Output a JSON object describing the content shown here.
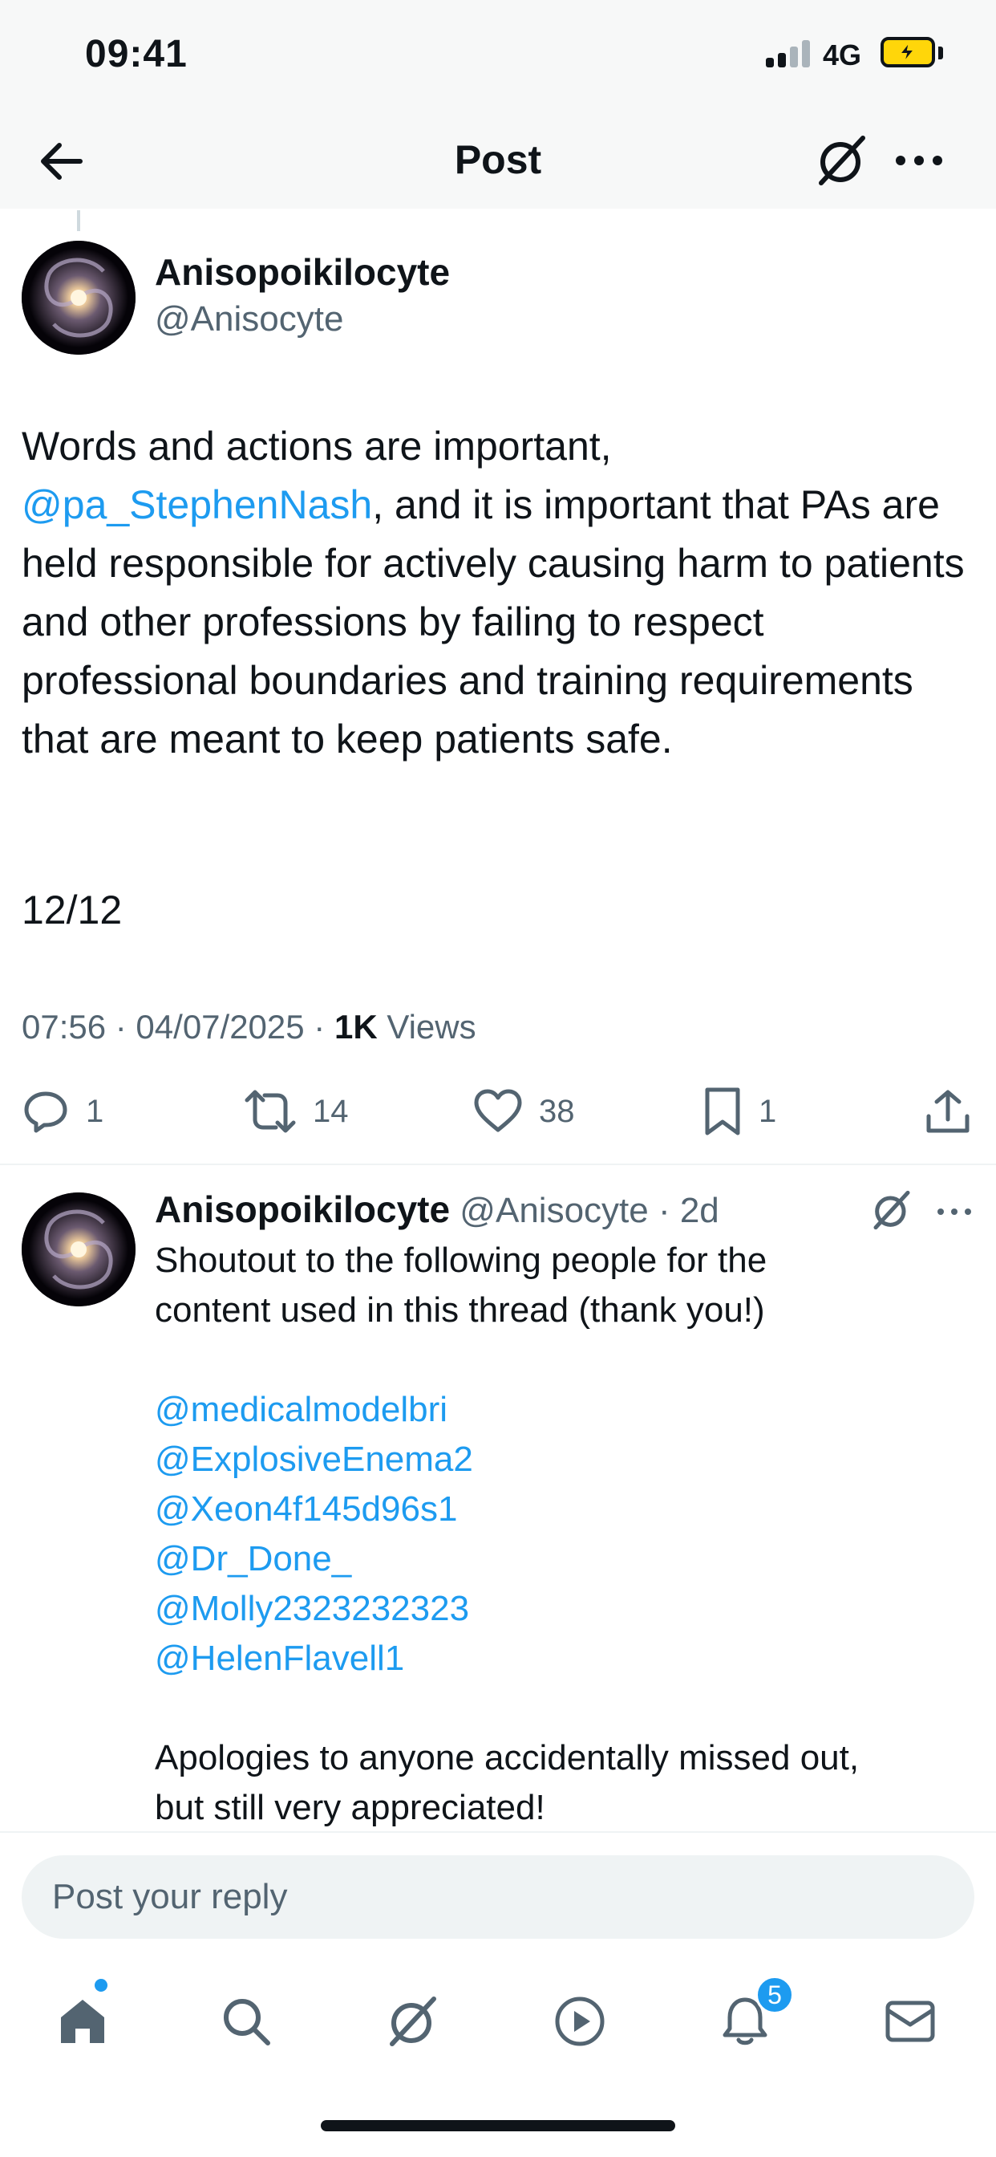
{
  "status_bar": {
    "time": "09:41",
    "network": "4G"
  },
  "header": {
    "title": "Post"
  },
  "post": {
    "author_name": "Anisopoikilocyte",
    "author_handle": "@Anisocyte",
    "text_before_mention": "Words and actions are important,",
    "mention": "@pa_StephenNash",
    "text_after_mention": ", and it is important that PAs are held responsible for actively causing harm to patients and other professions by failing to respect professional boundaries and training requirements that are meant to keep patients safe.",
    "thread_count": "12/12",
    "timestamp": "07:56 · 04/07/2025 · ",
    "views_count": "1K",
    "views_label": " Views",
    "replies": "1",
    "reposts": "14",
    "likes": "38",
    "bookmarks": "1"
  },
  "reply": {
    "author_name": "Anisopoikilocyte",
    "meta": " @Anisocyte · 2d",
    "lines": [
      "Shoutout to the following people for the",
      "content used in this thread (thank you!)"
    ],
    "mentions": [
      "@medicalmodelbri",
      "@ExplosiveEnema2",
      "@Xeon4f145d96s1",
      "@Dr_Done_",
      "@Molly2323232323",
      "@HelenFlavell1"
    ],
    "closing_lines": [
      "Apologies to anyone accidentally missed out,",
      "but still very appreciated!"
    ]
  },
  "reply_box": {
    "placeholder": "Post your reply"
  },
  "tab_bar": {
    "notifications_badge": "5"
  },
  "colors": {
    "accent": "#1d9bf0",
    "text": "#0f1419",
    "secondary": "#536471"
  }
}
